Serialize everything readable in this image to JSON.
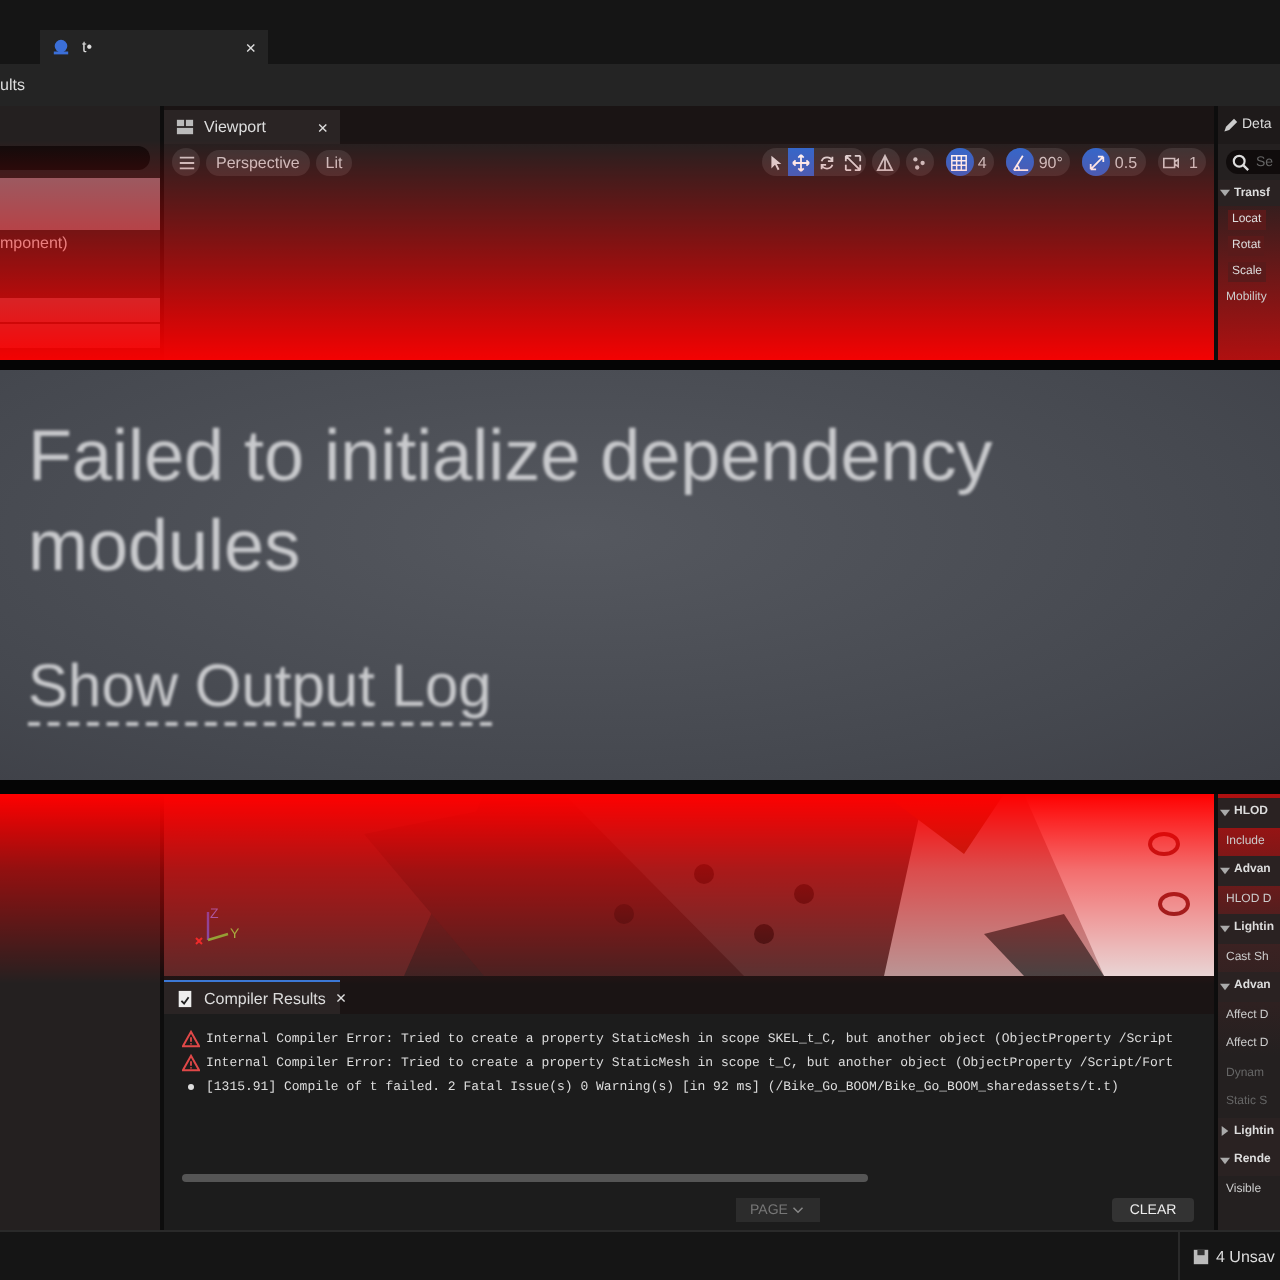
{
  "editor_tab": {
    "title": "t•",
    "close": "×"
  },
  "toolbar": {
    "label": "ults"
  },
  "outliner": {
    "rows": [
      {
        "selected": true
      },
      {
        "label": "mponent)",
        "selected": false
      },
      {
        "selected": true
      },
      {
        "selected": true
      }
    ]
  },
  "viewport": {
    "tab": "Viewport",
    "close": "×",
    "view_mode": "Perspective",
    "lighting": "Lit",
    "tools": [
      {
        "kind": "select",
        "selected": false
      },
      {
        "kind": "move",
        "selected": true
      },
      {
        "kind": "rotate",
        "selected": false
      },
      {
        "kind": "scale",
        "selected": false
      }
    ],
    "snaps": [
      {
        "kind": "grid",
        "value": "4",
        "on": true
      },
      {
        "kind": "angle",
        "value": "90°",
        "on": true
      },
      {
        "kind": "scale",
        "value": "0.5",
        "on": true
      },
      {
        "kind": "camera",
        "value": "1",
        "on": false
      }
    ],
    "axes": [
      "Z",
      "Y"
    ]
  },
  "error_banner": {
    "message": "Failed to initialize dependency modules",
    "link": "Show Output Log"
  },
  "compiler_results": {
    "tab": "Compiler Results",
    "close": "×",
    "lines": [
      {
        "kind": "error",
        "text": "Internal Compiler Error: Tried to create a property StaticMesh in scope SKEL_t_C, but another object (ObjectProperty /Script"
      },
      {
        "kind": "error",
        "text": "Internal Compiler Error: Tried to create a property StaticMesh in scope t_C, but another object (ObjectProperty /Script/Fort"
      },
      {
        "kind": "info",
        "text": "[1315.91] Compile of t failed. 2 Fatal Issue(s) 0 Warning(s) [in 92 ms] (/Bike_Go_BOOM/Bike_Go_BOOM_sharedassets/t.t)"
      }
    ],
    "page": "PAGE",
    "clear": "CLEAR"
  },
  "details": {
    "title": "Deta",
    "search_placeholder": "Se",
    "top_rows": [
      {
        "kind": "section",
        "label": "Transf",
        "expanded": true
      },
      {
        "kind": "field",
        "label": "Locat"
      },
      {
        "kind": "field",
        "label": "Rotat"
      },
      {
        "kind": "field",
        "label": "Scale"
      },
      {
        "kind": "property",
        "label": "Mobility",
        "disabled": false
      }
    ],
    "bottom_rows": [
      {
        "kind": "section",
        "label": "HLOD",
        "expanded": true
      },
      {
        "kind": "property",
        "label": "Include",
        "disabled": false
      },
      {
        "kind": "section",
        "label": "Advan",
        "expanded": true
      },
      {
        "kind": "property",
        "label": "HLOD D",
        "disabled": false
      },
      {
        "kind": "section",
        "label": "Lightin",
        "expanded": true
      },
      {
        "kind": "property",
        "label": "Cast Sh",
        "disabled": false
      },
      {
        "kind": "section",
        "label": "Advan",
        "expanded": true
      },
      {
        "kind": "property",
        "label": "Affect D",
        "disabled": false
      },
      {
        "kind": "property",
        "label": "Affect D",
        "disabled": false
      },
      {
        "kind": "property",
        "label": "Dynam",
        "disabled": true
      },
      {
        "kind": "property",
        "label": "Static S",
        "disabled": true
      },
      {
        "kind": "section",
        "label": "Lightin",
        "expanded": false
      },
      {
        "kind": "section",
        "label": "Rende",
        "expanded": true
      },
      {
        "kind": "property",
        "label": "Visible",
        "disabled": false
      }
    ]
  },
  "status_bar": {
    "unsaved": "4 Unsav"
  }
}
